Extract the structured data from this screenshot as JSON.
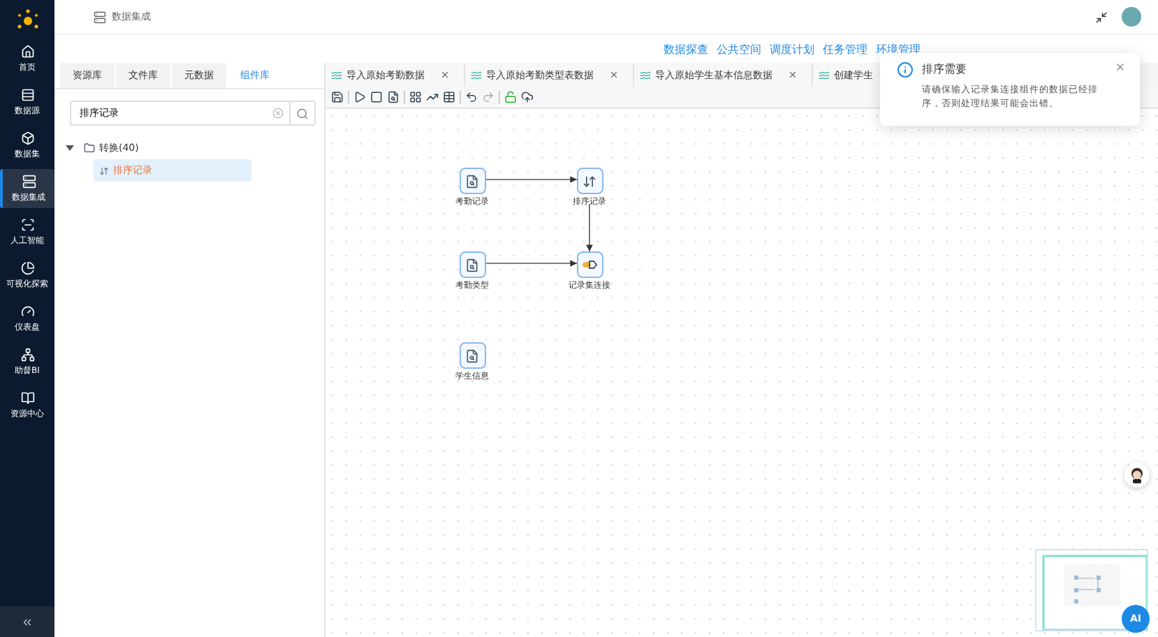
{
  "sidebar": {
    "items": [
      {
        "label": "首页",
        "selected": false
      },
      {
        "label": "数据源",
        "selected": false
      },
      {
        "label": "数据集",
        "selected": false
      },
      {
        "label": "数据集成",
        "selected": true
      },
      {
        "label": "人工智能",
        "selected": false
      },
      {
        "label": "可视化探索",
        "selected": false
      },
      {
        "label": "仪表盘",
        "selected": false
      },
      {
        "label": "助督BI",
        "selected": false
      },
      {
        "label": "资源中心",
        "selected": false
      }
    ]
  },
  "breadcrumb": "数据集成",
  "header_links": [
    "数据探查",
    "公共空间",
    "调度计划",
    "任务管理",
    "环境管理"
  ],
  "left_panel": {
    "tabs": [
      {
        "label": "资源库",
        "selected": false
      },
      {
        "label": "文件库",
        "selected": false
      },
      {
        "label": "元数据",
        "selected": false
      },
      {
        "label": "组件库",
        "selected": true
      }
    ],
    "search": {
      "value": "排序记录"
    },
    "tree": [
      {
        "label": "转换(40)",
        "expanded": true,
        "children": [
          {
            "label": "排序记录",
            "selected": true
          }
        ]
      }
    ]
  },
  "canvas_tabs": [
    {
      "label": "导入原始考勤数据",
      "closable": true
    },
    {
      "label": "导入原始考勤类型表数据",
      "closable": true
    },
    {
      "label": "导入原始学生基本信息数据",
      "closable": true
    },
    {
      "label": "创建学生",
      "closable": false
    }
  ],
  "nodes": [
    {
      "label": "考勤记录",
      "kind": "input"
    },
    {
      "label": "排序记录",
      "kind": "sort"
    },
    {
      "label": "考勤类型",
      "kind": "input"
    },
    {
      "label": "记录集连接",
      "kind": "join"
    },
    {
      "label": "学生信息",
      "kind": "input"
    }
  ],
  "toast": {
    "title": "排序需要",
    "message": "请确保输入记录集连接组件的数据已经排序，否则处理结果可能会出错。"
  },
  "ai_button": "AI"
}
